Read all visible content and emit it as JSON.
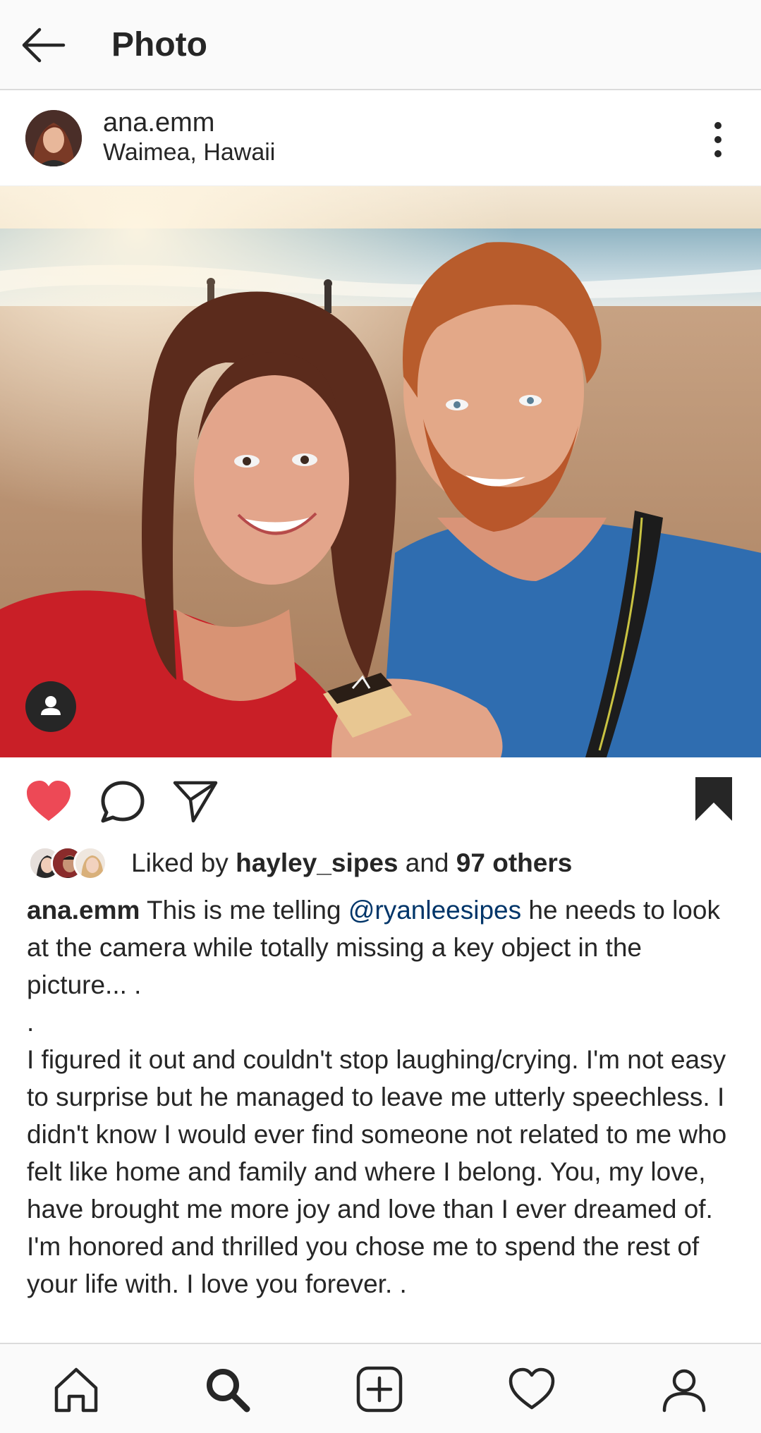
{
  "app_bar": {
    "title": "Photo",
    "back_icon": "arrow-left-icon"
  },
  "post": {
    "username": "ana.emm",
    "location": "Waimea, Hawaii",
    "more_icon": "vertical-ellipsis-icon",
    "photo_description_icon": "user-tag-icon",
    "liked": true,
    "saved": true
  },
  "likes": {
    "prefix": "Liked by ",
    "user": "hayley_sipes",
    "middle": " and ",
    "others": "97 others"
  },
  "caption": {
    "username": "ana.emm",
    "text_before_mention": " This is me telling ",
    "mention": "@ryanleesipes",
    "text_after_mention": " he needs to look at the camera while totally missing a key object in the picture... .",
    "separator": ".",
    "paragraph": "I figured it out and couldn't stop laughing/crying. I'm not easy to surprise but he managed to leave me utterly speechless. I didn't know I would ever find someone not related to me who felt like home and family and where I belong. You, my love, have brought me more joy and love than I ever dreamed of. I'm honored and thrilled you chose me to spend the rest of your life with. I love you forever. ."
  },
  "actions": {
    "like_icon": "heart-filled-icon",
    "comment_icon": "comment-icon",
    "share_icon": "paper-plane-icon",
    "save_icon": "bookmark-filled-icon"
  },
  "bottom_nav": [
    "home-icon",
    "search-icon",
    "add-post-icon",
    "activity-heart-icon",
    "profile-icon"
  ],
  "colors": {
    "like_red": "#ed4956",
    "mention_blue": "#003569",
    "text": "#262626",
    "bar_bg": "#fafafa",
    "divider": "#dbdbdb"
  }
}
